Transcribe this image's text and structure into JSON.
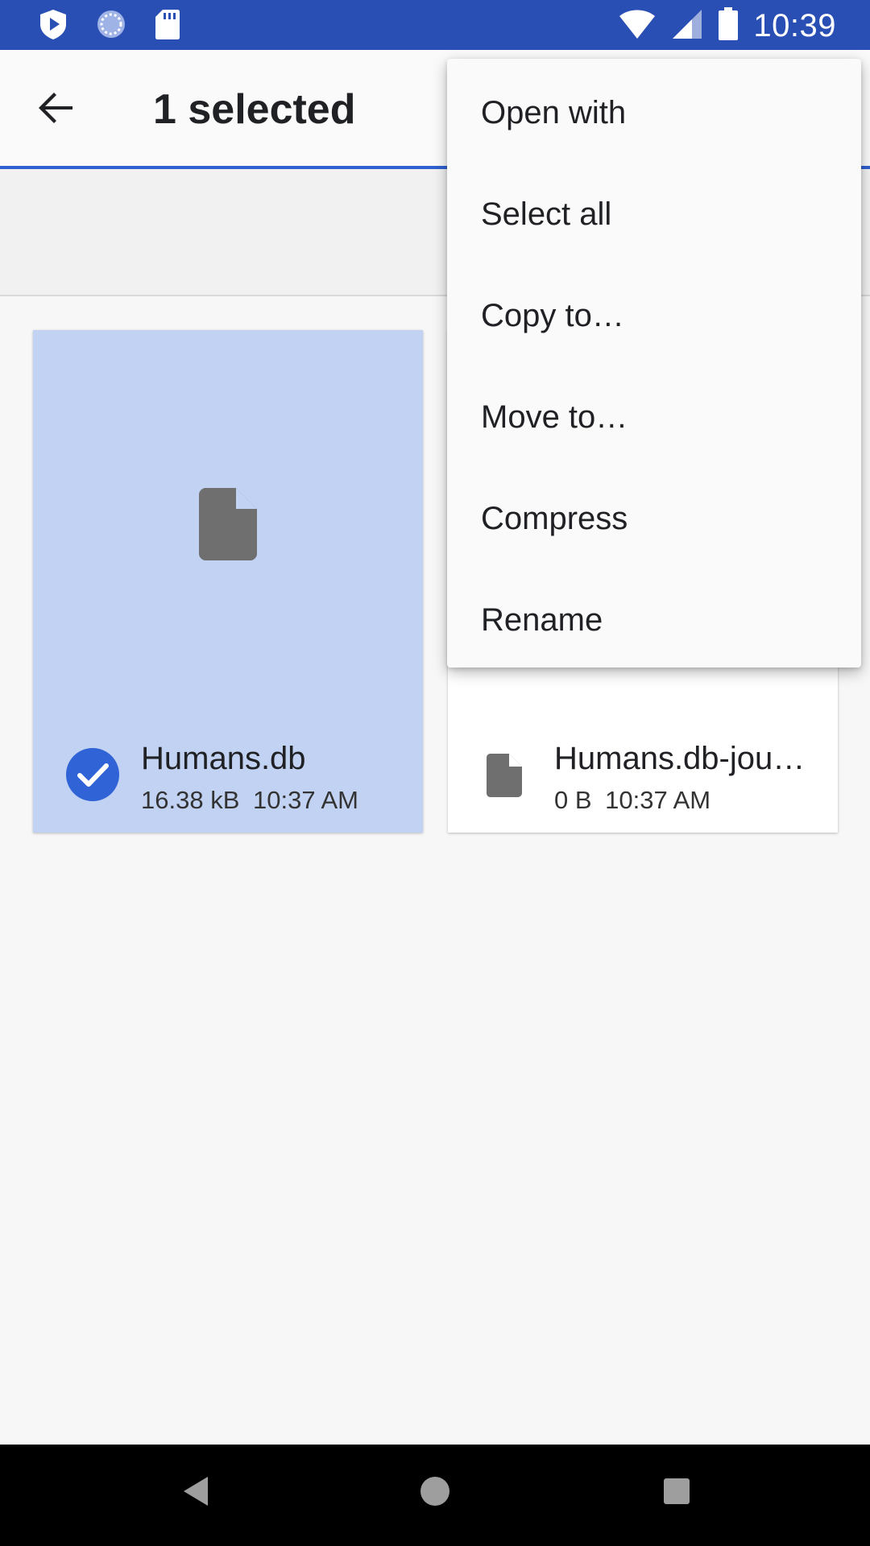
{
  "status_bar": {
    "time": "10:39",
    "icons_left": [
      "play-shield-icon",
      "sync-circle-icon",
      "sd-card-icon"
    ],
    "icons_right": [
      "wifi-icon",
      "cell-signal-icon",
      "battery-icon"
    ]
  },
  "app_bar": {
    "title": "1 selected",
    "back_icon": "arrow-back-icon"
  },
  "files": [
    {
      "name": "Humans.db",
      "size": "16.38 kB",
      "time": "10:37 AM",
      "selected": true
    },
    {
      "name": "Humans.db-jou…",
      "size": "0 B",
      "time": "10:37 AM",
      "selected": false
    }
  ],
  "menu": {
    "items": [
      "Open with",
      "Select all",
      "Copy to…",
      "Move to…",
      "Compress",
      "Rename"
    ]
  },
  "nav_bar": {
    "buttons": [
      "back-triangle-icon",
      "home-circle-icon",
      "recents-square-icon"
    ]
  },
  "colors": {
    "status_bar": "#2a4fb4",
    "accent": "#2f5fd0",
    "selected_card": "#c2d2f2",
    "check": "#2f63d6"
  }
}
